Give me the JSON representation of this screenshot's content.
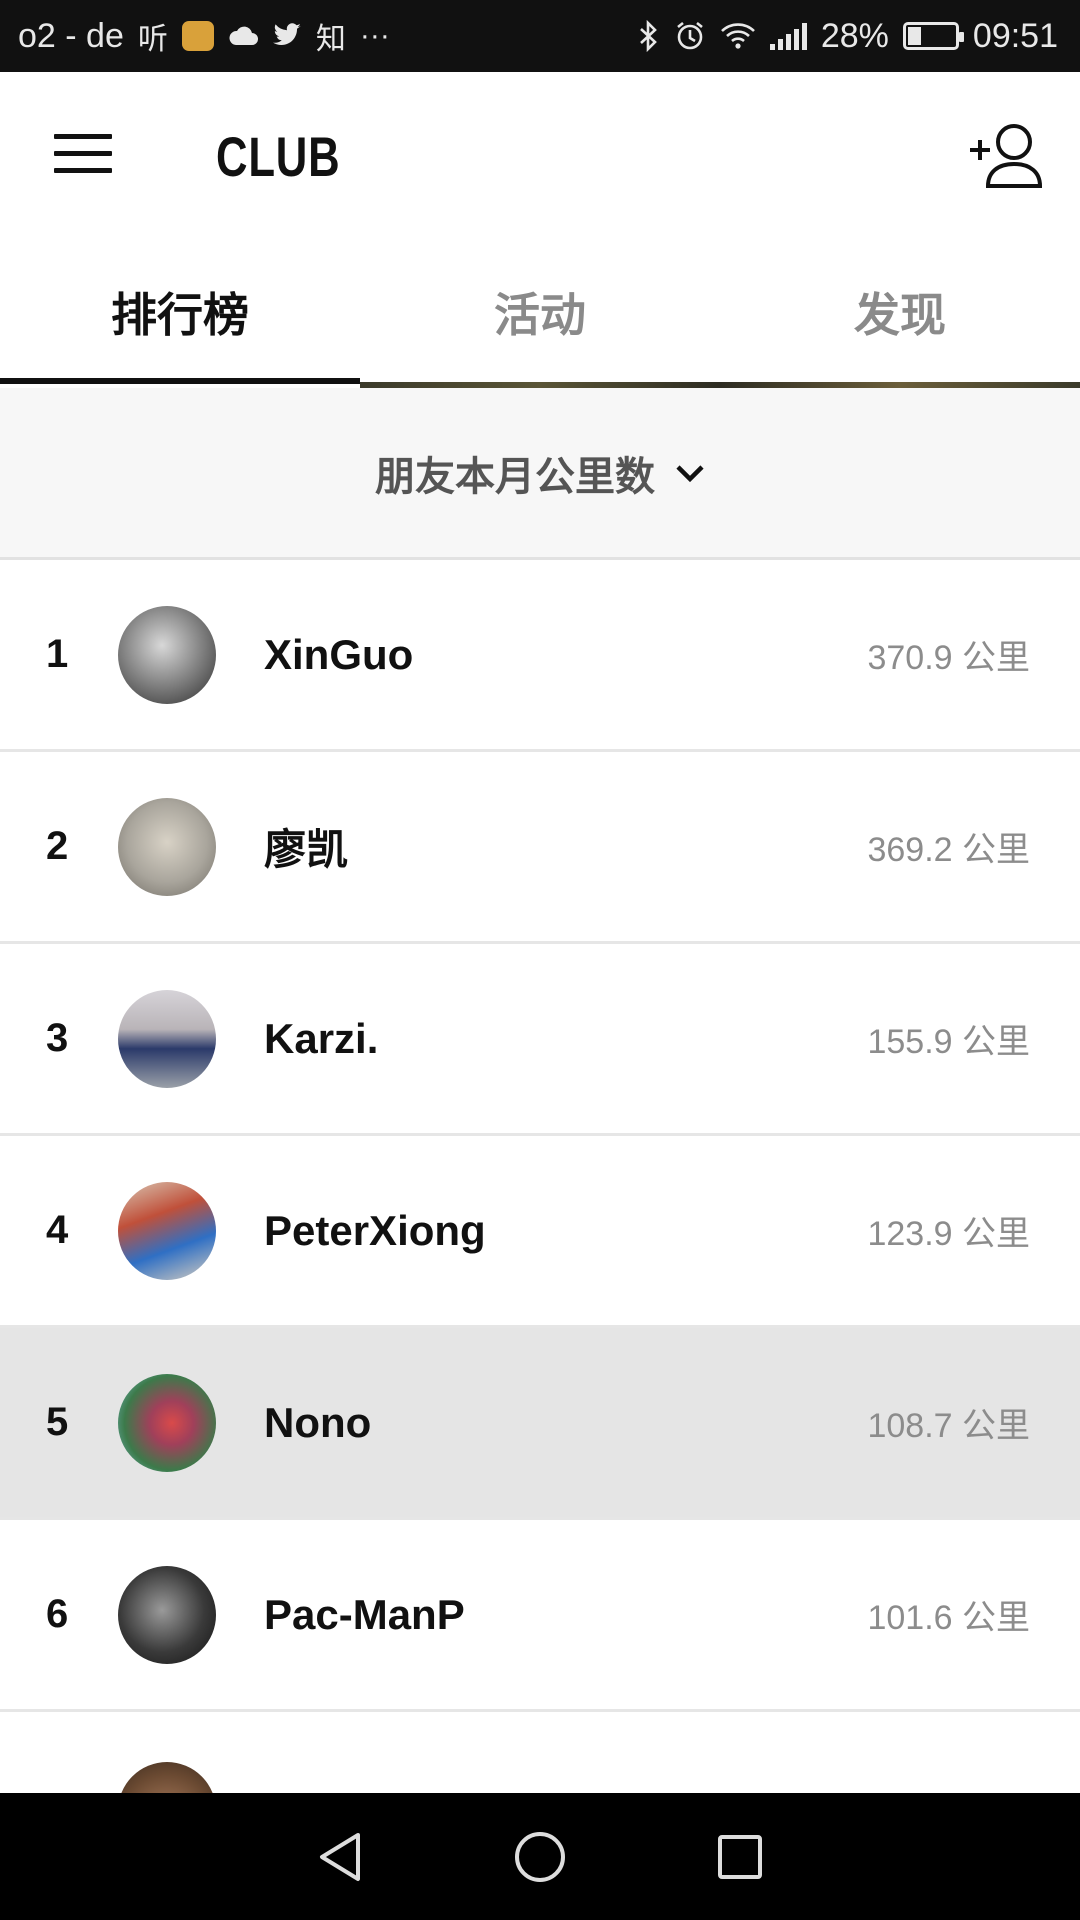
{
  "status_bar": {
    "carrier": "o2 - de",
    "extra_glyphs": [
      "听",
      "知",
      "···"
    ],
    "battery": "28%",
    "time": "09:51",
    "battery_level": 0.28,
    "icons": [
      "bluetooth-icon",
      "alarm-icon",
      "wifi-icon",
      "signal-icon",
      "battery-icon"
    ]
  },
  "app_bar": {
    "title": "CLUB",
    "menu_icon": "hamburger-icon",
    "action_icon": "add-friend-icon"
  },
  "tabs": [
    {
      "label": "排行榜",
      "active": true
    },
    {
      "label": "活动",
      "active": false
    },
    {
      "label": "发现",
      "active": false
    }
  ],
  "filter": {
    "label": "朋友本月公里数",
    "icon": "chevron-down-icon"
  },
  "leaderboard": [
    {
      "rank": "1",
      "name": "XinGuo",
      "distance": "370.9 公里",
      "avatar_color": "#6f6f6f"
    },
    {
      "rank": "2",
      "name": "廖凯",
      "distance": "369.2 公里",
      "avatar_color": "#a9a59c"
    },
    {
      "rank": "3",
      "name": "Karzi.",
      "distance": "155.9 公里",
      "avatar_color": "#b9b4b8"
    },
    {
      "rank": "4",
      "name": "PeterXiong",
      "distance": "123.9 公里",
      "avatar_color": "#c0503a"
    },
    {
      "rank": "5",
      "name": "Nono",
      "distance": "108.7 公里",
      "avatar_color": "#5a8a4a",
      "highlighted": true
    },
    {
      "rank": "6",
      "name": "Pac-ManP",
      "distance": "101.6 公里",
      "avatar_color": "#3a3a3a"
    }
  ],
  "nav_bar": {
    "icons": [
      "back-icon",
      "home-icon",
      "recents-icon"
    ]
  },
  "colors": {
    "status_bg": "#111111",
    "highlight_row": "#e5e5e5",
    "filter_bg": "#f7f7f7",
    "inactive_tab": "#8a8a8a"
  }
}
